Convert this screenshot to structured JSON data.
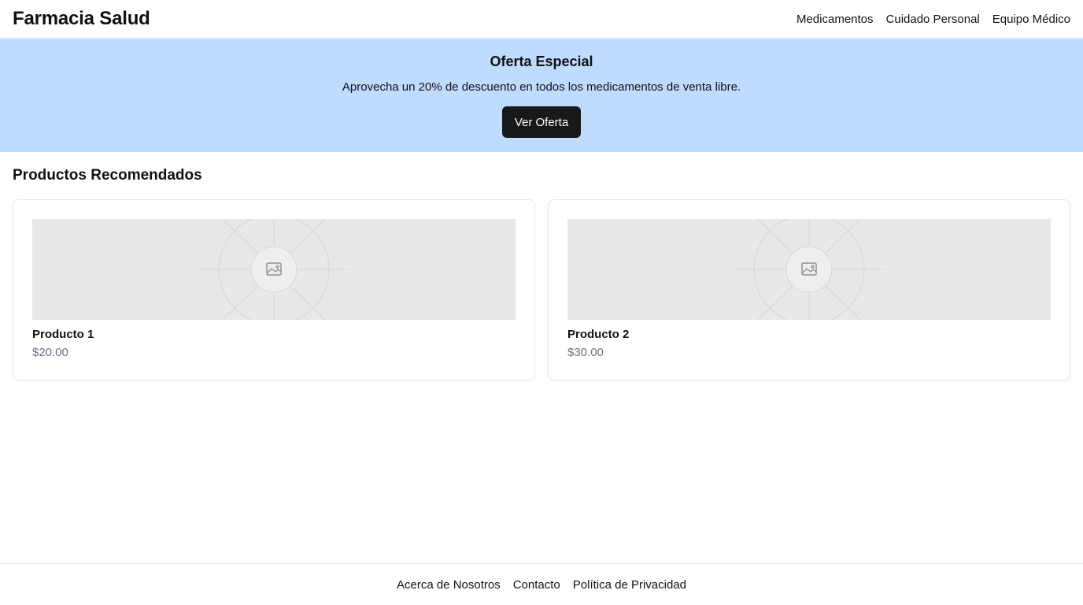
{
  "header": {
    "brand": "Farmacia Salud",
    "nav": [
      "Medicamentos",
      "Cuidado Personal",
      "Equipo Médico"
    ]
  },
  "banner": {
    "title": "Oferta Especial",
    "text": "Aprovecha un 20% de descuento en todos los medicamentos de venta libre.",
    "button_label": "Ver Oferta",
    "background_color": "#bfdbfe",
    "button_color": "#18181b"
  },
  "recommended": {
    "title": "Productos Recomendados",
    "products": [
      {
        "name": "Producto 1",
        "price": "$20.00",
        "image_icon": "image-placeholder-icon"
      },
      {
        "name": "Producto 2",
        "price": "$30.00",
        "image_icon": "image-placeholder-icon"
      }
    ]
  },
  "footer": {
    "links": [
      "Acerca de Nosotros",
      "Contacto",
      "Política de Privacidad"
    ]
  }
}
